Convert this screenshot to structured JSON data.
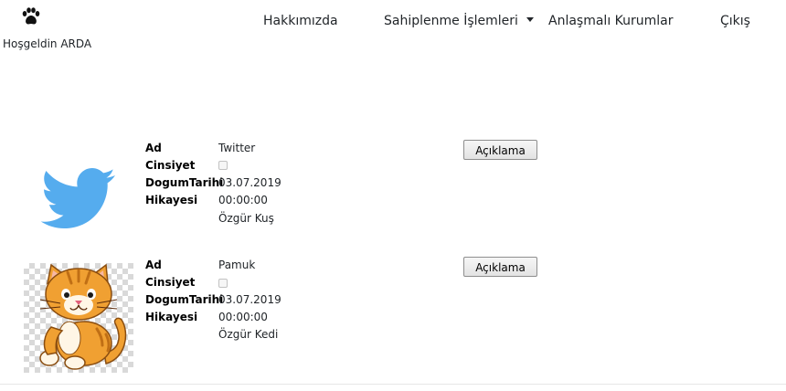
{
  "header": {
    "logo_icon": "paw-icon",
    "welcome_text": "Hoşgeldin ARDA",
    "nav": {
      "about": "Hakkımızda",
      "adoption": "Sahiplenme İşlemleri",
      "partners": "Anlaşmalı Kurumlar",
      "logout": "Çıkış"
    }
  },
  "labels": {
    "name": "Ad",
    "gender": "Cinsiyet",
    "birth_date": "DogumTarihi",
    "story": "Hikayesi"
  },
  "animals": [
    {
      "image_icon": "twitter-bird-icon",
      "name": "Twitter",
      "gender_checked": false,
      "birth_date": "03.07.2019",
      "birth_time": "00:00:00",
      "story": "Özgür Kuş",
      "button_label": "Açıklama"
    },
    {
      "image_icon": "cat-icon",
      "name": "Pamuk",
      "gender_checked": false,
      "birth_date": "03.07.2019",
      "birth_time": "00:00:00",
      "story": "Özgür Kedi",
      "button_label": "Açıklama"
    }
  ],
  "colors": {
    "twitter_blue": "#55acee",
    "cat_orange": "#f0a032",
    "text": "#212529"
  }
}
